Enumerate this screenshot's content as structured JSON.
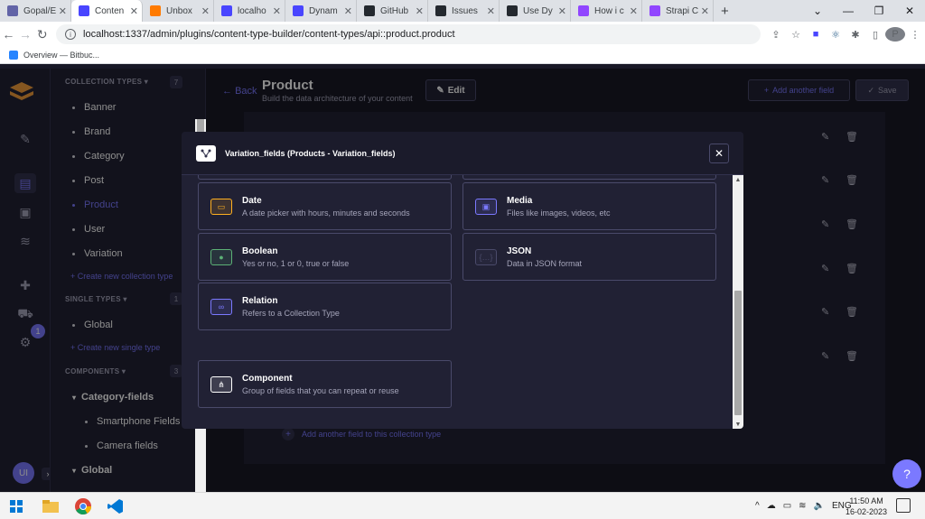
{
  "browser": {
    "tabs": [
      {
        "label": "Gopal/E",
        "color": "#6264a7"
      },
      {
        "label": "Conten",
        "color": "#4945ff",
        "active": true
      },
      {
        "label": "Unbox",
        "color": "#ff7a00"
      },
      {
        "label": "localho",
        "color": "#4945ff"
      },
      {
        "label": "Dynam",
        "color": "#4945ff"
      },
      {
        "label": "GitHub",
        "color": "#24292f"
      },
      {
        "label": "Issues",
        "color": "#24292f"
      },
      {
        "label": "Use Dy",
        "color": "#24292f"
      },
      {
        "label": "How i c",
        "color": "#9146ff"
      },
      {
        "label": "Strapi C",
        "color": "#9146ff"
      }
    ],
    "url": "localhost:1337/admin/plugins/content-type-builder/content-types/api::product.product",
    "bookmark": "Overview — Bitbuc...",
    "profile_initial": "P"
  },
  "rail": {
    "badge": "1",
    "user_initials": "UI"
  },
  "subnav": {
    "collection_types": {
      "title": "COLLECTION TYPES",
      "count": "7",
      "items": [
        "Banner",
        "Brand",
        "Category",
        "Post",
        "Product",
        "User",
        "Variation"
      ],
      "create": "Create new collection type"
    },
    "single_types": {
      "title": "SINGLE TYPES",
      "count": "1",
      "items": [
        "Global"
      ],
      "create": "Create new single type"
    },
    "components": {
      "title": "COMPONENTS",
      "count": "3",
      "group1": "Category-fields",
      "group1_items": [
        "Smartphone Fields",
        "Camera fields"
      ],
      "group2": "Global"
    }
  },
  "header": {
    "back": "Back",
    "title": "Product",
    "subtitle": "Build the data architecture of your content",
    "edit": "Edit",
    "add_field": "Add another field",
    "save": "Save"
  },
  "main": {
    "add_field_link": "Add another field to this collection type"
  },
  "modal": {
    "title": "Variation_fields (Products - Variation_fields)",
    "options": [
      {
        "name": "Date",
        "desc": "A date picker with hours, minutes and seconds",
        "icon": "calendar-icon",
        "color": "#ffb020"
      },
      {
        "name": "Media",
        "desc": "Files like images, videos, etc",
        "icon": "media-icon",
        "color": "#7b79ff"
      },
      {
        "name": "Boolean",
        "desc": "Yes or no, 1 or 0, true or false",
        "icon": "toggle-icon",
        "color": "#5cb176"
      },
      {
        "name": "JSON",
        "desc": "Data in JSON format",
        "icon": "json-icon",
        "color": "#4a4a6a"
      },
      {
        "name": "Relation",
        "desc": "Refers to a Collection Type",
        "icon": "link-icon",
        "color": "#7b79ff"
      },
      {
        "name": "Component",
        "desc": "Group of fields that you can repeat or reuse",
        "icon": "component-icon",
        "color": "#ffffff"
      }
    ]
  },
  "taskbar": {
    "lang": "ENG",
    "time": "11:50 AM",
    "date": "16-02-2023"
  }
}
